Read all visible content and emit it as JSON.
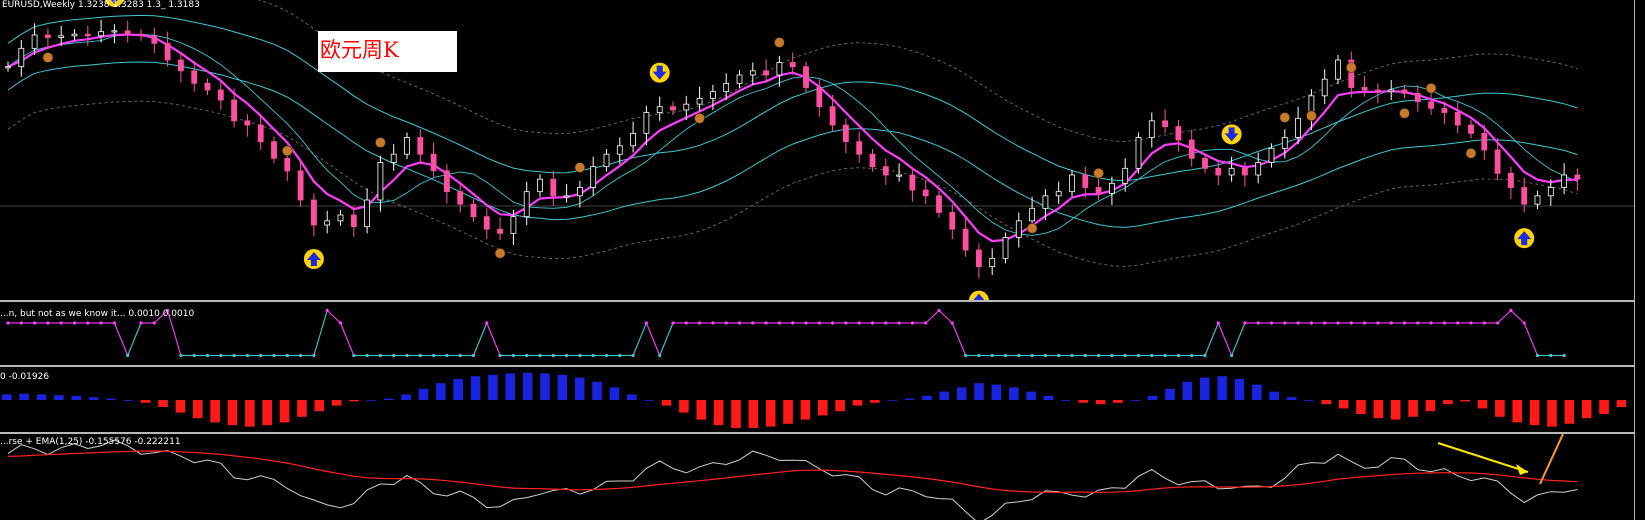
{
  "chart_header": {
    "text": "EURUSD,Weekly  1.3238 1.3283 1.3_ 1.3183"
  },
  "title": {
    "text": "欧元周K"
  },
  "pane2_header": {
    "text": "...n, but not as we know it...  0.0010 0.0010"
  },
  "pane3_header": {
    "text": "0 -0.01926"
  },
  "pane4_header": {
    "text": "...rse + EMA(1,25) -0.155576 -0.222211"
  },
  "colors": {
    "background": "#000000",
    "ma_fast": "#ff3cff",
    "envelope": "#3cc8d2",
    "bollinger": "#6e6e6e",
    "candle_bull": "#ffffff",
    "candle_bear": "#ff4fa0",
    "arrow_marker": "#ffd400",
    "fractal_marker": "#c87a2a",
    "hist_pos": "#1a24e0",
    "hist_neg": "#ff1a1a",
    "osc_line": "#cfcfcf",
    "ema_line": "#ff2020",
    "annotation_yellow": "#ffe600",
    "annotation_orange": "#ff9a2a"
  },
  "chart_data": [
    {
      "type": "line",
      "name": "weekly-candles",
      "series": [
        {
          "values": [
            1.31,
            1.332,
            1.348,
            1.345,
            1.347,
            1.349,
            1.347,
            1.352,
            1.353,
            1.349,
            1.347,
            1.338,
            1.318,
            1.305,
            1.29,
            1.282,
            1.27,
            1.245,
            1.24,
            1.22,
            1.2,
            1.185,
            1.15,
            1.12,
            1.125,
            1.132,
            1.118,
            1.15,
            1.195,
            1.205,
            1.225,
            1.205,
            1.185,
            1.16,
            1.145,
            1.13,
            1.115,
            1.11,
            1.13,
            1.16,
            1.175,
            1.155,
            1.155,
            1.165,
            1.19,
            1.205,
            1.215,
            1.23,
            1.255,
            1.262,
            1.258,
            1.265,
            1.272,
            1.28,
            1.29,
            1.3,
            1.305,
            1.3,
            1.315,
            1.31,
            1.285,
            1.262,
            1.24,
            1.22,
            1.205,
            1.19,
            1.18,
            1.18,
            1.162,
            1.155,
            1.135,
            1.115,
            1.09,
            1.07,
            1.08,
            1.105,
            1.125,
            1.14,
            1.155,
            1.16,
            1.18,
            1.165,
            1.158,
            1.17,
            1.188,
            1.225,
            1.245,
            1.238,
            1.222,
            1.2,
            1.188,
            1.18,
            1.188,
            1.18,
            1.195,
            1.212,
            1.225,
            1.248,
            1.275,
            1.295,
            1.318,
            1.285,
            1.282,
            1.28,
            1.282,
            1.278,
            1.268,
            1.26,
            1.255,
            1.24,
            1.23,
            1.21,
            1.182,
            1.165,
            1.145,
            1.155,
            1.165,
            1.18,
            1.175
          ]
        }
      ]
    },
    {
      "type": "bar",
      "name": "momentum-histogram",
      "series": [
        {
          "values": [
            0.004,
            0.0045,
            0.004,
            0.0035,
            0.003,
            0.002,
            0.001,
            0.0,
            -0.002,
            -0.005,
            -0.009,
            -0.013,
            -0.016,
            -0.018,
            -0.019,
            -0.018,
            -0.016,
            -0.012,
            -0.008,
            -0.004,
            -0.001,
            0.0,
            0.001,
            0.004,
            0.008,
            0.012,
            0.015,
            0.017,
            0.018,
            0.019,
            0.0195,
            0.019,
            0.018,
            0.016,
            0.013,
            0.009,
            0.004,
            0.0,
            -0.004,
            -0.009,
            -0.014,
            -0.018,
            -0.02,
            -0.02,
            -0.019,
            -0.017,
            -0.014,
            -0.011,
            -0.008,
            -0.004,
            -0.002,
            0.0,
            0.001,
            0.003,
            0.006,
            0.009,
            0.012,
            0.011,
            0.009,
            0.006,
            0.003,
            0.0,
            -0.002,
            -0.003,
            -0.002,
            0.0,
            0.003,
            0.008,
            0.013,
            0.016,
            0.017,
            0.015,
            0.011,
            0.006,
            0.002,
            0.0,
            -0.003,
            -0.006,
            -0.01,
            -0.013,
            -0.014,
            -0.012,
            -0.008,
            -0.003,
            -0.001,
            -0.006,
            -0.012,
            -0.016,
            -0.018,
            -0.019,
            -0.017,
            -0.013,
            -0.01,
            -0.005
          ]
        }
      ]
    }
  ]
}
